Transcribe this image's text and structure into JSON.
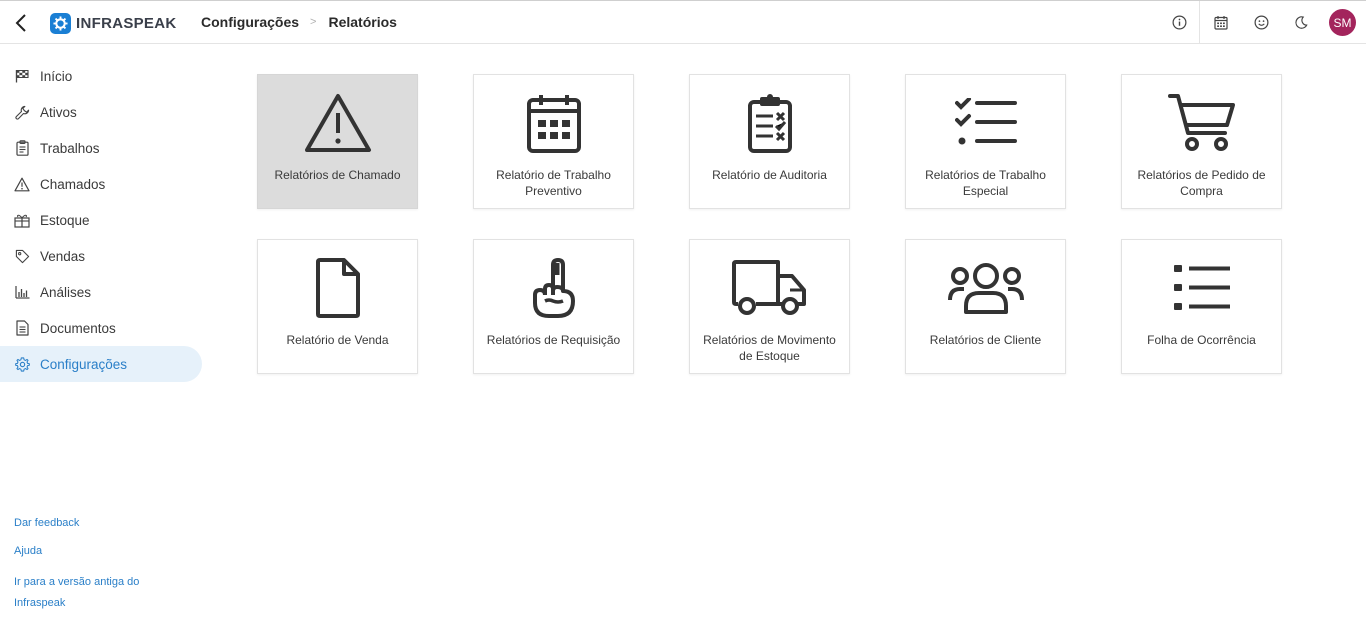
{
  "header": {
    "logo_text": "INFRASPEAK",
    "breadcrumb": [
      "Configurações",
      "Relatórios"
    ],
    "breadcrumb_sep": ">",
    "avatar_initials": "SM",
    "avatar_color": "#a3245c"
  },
  "sidebar": {
    "items": [
      {
        "label": "Início",
        "icon": "flag-icon"
      },
      {
        "label": "Ativos",
        "icon": "wrench-icon"
      },
      {
        "label": "Trabalhos",
        "icon": "clipboard-icon"
      },
      {
        "label": "Chamados",
        "icon": "warning-icon"
      },
      {
        "label": "Estoque",
        "icon": "boxes-icon"
      },
      {
        "label": "Vendas",
        "icon": "tag-icon"
      },
      {
        "label": "Análises",
        "icon": "bar-chart-icon"
      },
      {
        "label": "Documentos",
        "icon": "document-icon"
      },
      {
        "label": "Configurações",
        "icon": "gear-icon",
        "active": true
      }
    ],
    "footer": {
      "feedback": "Dar feedback",
      "help": "Ajuda",
      "old_version": "Ir para a versão antiga do Infraspeak"
    }
  },
  "reports": [
    {
      "label": "Relatórios de Chamado",
      "icon": "warning-icon",
      "selected": true
    },
    {
      "label": "Relatório de Trabalho Preventivo",
      "icon": "calendar-icon"
    },
    {
      "label": "Relatório de Auditoria",
      "icon": "audit-clipboard-icon"
    },
    {
      "label": "Relatórios de Trabalho Especial",
      "icon": "checklist-icon"
    },
    {
      "label": "Relatórios de Pedido de Compra",
      "icon": "shopping-cart-icon"
    },
    {
      "label": "Relatório de Venda",
      "icon": "file-icon"
    },
    {
      "label": "Relatórios de Requisição",
      "icon": "hand-pointing-icon"
    },
    {
      "label": "Relatórios de Movimento de Estoque",
      "icon": "truck-icon"
    },
    {
      "label": "Relatórios de Cliente",
      "icon": "users-icon"
    },
    {
      "label": "Folha de Ocorrência",
      "icon": "list-icon"
    }
  ],
  "colors": {
    "accent": "#2a7fc8",
    "active_bg": "#e6f1fa",
    "selected_card_bg": "#dcdcdc"
  }
}
